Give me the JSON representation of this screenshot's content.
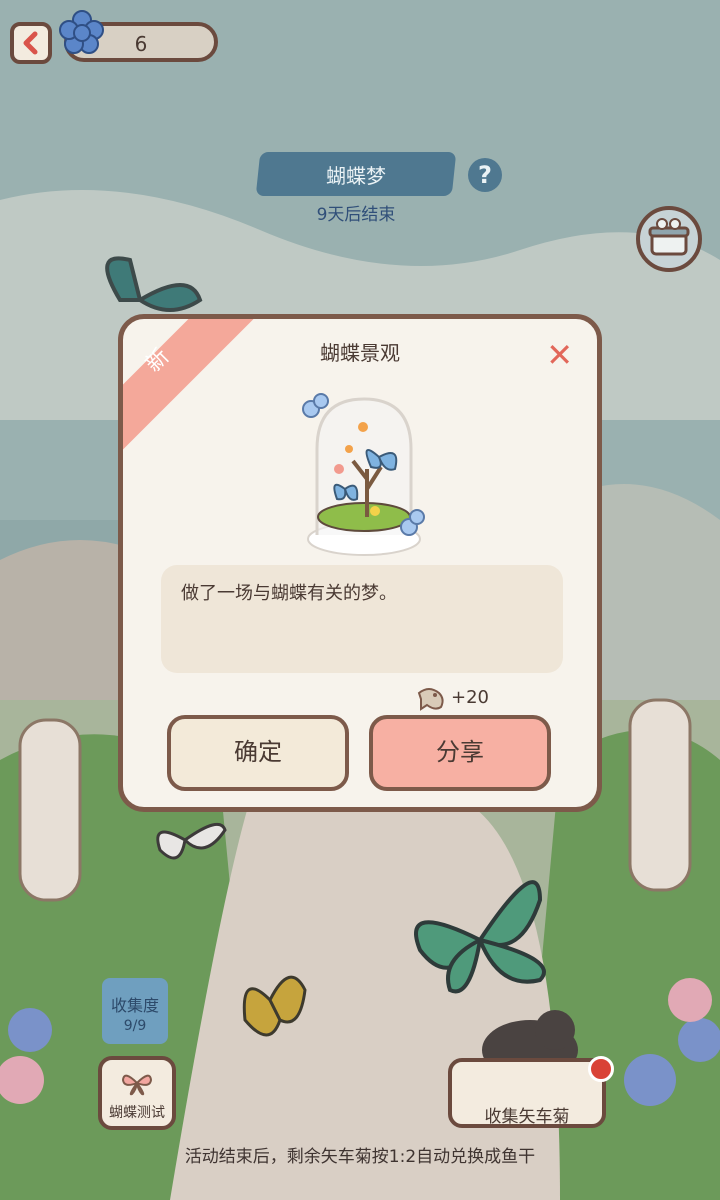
{
  "top_bar": {
    "currency_value": "6"
  },
  "event": {
    "title": "蝴蝶梦",
    "help_glyph": "?",
    "timer": "9天后结束"
  },
  "modal": {
    "ribbon": "新",
    "title": "蝴蝶景观",
    "close_glyph": "✕",
    "description": "做了一场与蝴蝶有关的梦。",
    "reward_value": "+20",
    "confirm_label": "确定",
    "share_label": "分享"
  },
  "bottom": {
    "collection_label": "收集度",
    "collection_value": "9/9",
    "test_label": "蝴蝶测试",
    "gather_label": "收集矢车菊",
    "note": "活动结束后，剩余矢车菊按1:2自动兑换成鱼干"
  },
  "colors": {
    "accent_brown": "#7d5a4a",
    "share_pink": "#f7b0a3",
    "confirm_cream": "#f3ead9",
    "close_red": "#e2675a"
  }
}
